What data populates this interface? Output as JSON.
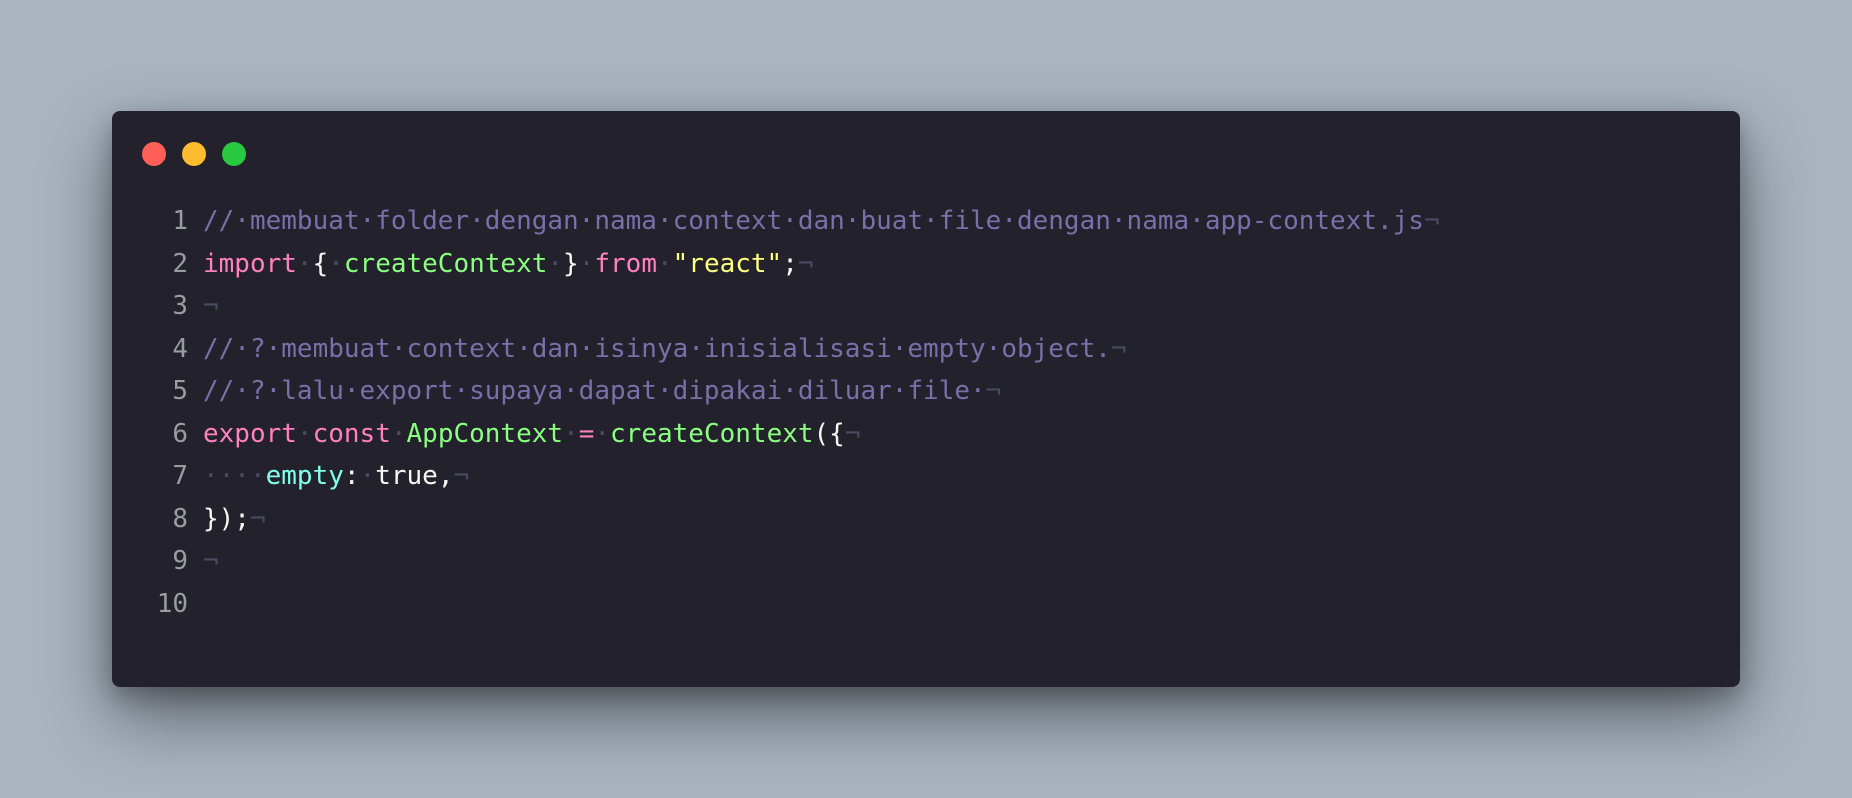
{
  "window": {
    "buttons": {
      "close_color": "#ff5f57",
      "minimize_color": "#febc2e",
      "maximize_color": "#28c840"
    },
    "background": "#22212c"
  },
  "editor": {
    "theme": {
      "comment": "#7970a9",
      "keyword": "#ff80bf",
      "function": "#8aff80",
      "string": "#ffff80",
      "property": "#80ffea",
      "plain": "#f8f8f2",
      "whitespace_marker": "#4a4b63",
      "line_number": "#9b9ba2"
    },
    "lines": [
      {
        "number": "1",
        "tokens": [
          {
            "text": "//·membuat·folder·dengan·nama·context·dan·buat·file·dengan·nama·app-context.js",
            "type": "comment"
          },
          {
            "text": "¬",
            "type": "ws"
          }
        ]
      },
      {
        "number": "2",
        "tokens": [
          {
            "text": "import",
            "type": "kw"
          },
          {
            "text": "·",
            "type": "ws"
          },
          {
            "text": "{",
            "type": "plain"
          },
          {
            "text": "·",
            "type": "ws"
          },
          {
            "text": "createContext",
            "type": "fn"
          },
          {
            "text": "·",
            "type": "ws"
          },
          {
            "text": "}",
            "type": "plain"
          },
          {
            "text": "·",
            "type": "ws"
          },
          {
            "text": "from",
            "type": "kw"
          },
          {
            "text": "·",
            "type": "ws"
          },
          {
            "text": "\"react\"",
            "type": "str"
          },
          {
            "text": ";",
            "type": "plain"
          },
          {
            "text": "¬",
            "type": "ws"
          }
        ]
      },
      {
        "number": "3",
        "tokens": [
          {
            "text": "¬",
            "type": "ws"
          }
        ]
      },
      {
        "number": "4",
        "tokens": [
          {
            "text": "//·?·membuat·context·dan·isinya·inisialisasi·empty·object.",
            "type": "comment"
          },
          {
            "text": "¬",
            "type": "ws"
          }
        ]
      },
      {
        "number": "5",
        "tokens": [
          {
            "text": "//·?·lalu·export·supaya·dapat·dipakai·diluar·file·",
            "type": "comment"
          },
          {
            "text": "¬",
            "type": "ws"
          }
        ]
      },
      {
        "number": "6",
        "tokens": [
          {
            "text": "export",
            "type": "kw"
          },
          {
            "text": "·",
            "type": "ws"
          },
          {
            "text": "const",
            "type": "kw"
          },
          {
            "text": "·",
            "type": "ws"
          },
          {
            "text": "AppContext",
            "type": "fn"
          },
          {
            "text": "·",
            "type": "ws"
          },
          {
            "text": "=",
            "type": "kw"
          },
          {
            "text": "·",
            "type": "ws"
          },
          {
            "text": "createContext",
            "type": "fn"
          },
          {
            "text": "({",
            "type": "plain"
          },
          {
            "text": "¬",
            "type": "ws"
          }
        ]
      },
      {
        "number": "7",
        "tokens": [
          {
            "text": "····",
            "type": "ws"
          },
          {
            "text": "empty",
            "type": "prop"
          },
          {
            "text": ":",
            "type": "plain"
          },
          {
            "text": "·",
            "type": "ws"
          },
          {
            "text": "true",
            "type": "plain"
          },
          {
            "text": ",",
            "type": "plain"
          },
          {
            "text": "¬",
            "type": "ws"
          }
        ]
      },
      {
        "number": "8",
        "tokens": [
          {
            "text": "});",
            "type": "plain"
          },
          {
            "text": "¬",
            "type": "ws"
          }
        ]
      },
      {
        "number": "9",
        "tokens": [
          {
            "text": "¬",
            "type": "ws"
          }
        ]
      },
      {
        "number": "10",
        "tokens": []
      }
    ]
  }
}
